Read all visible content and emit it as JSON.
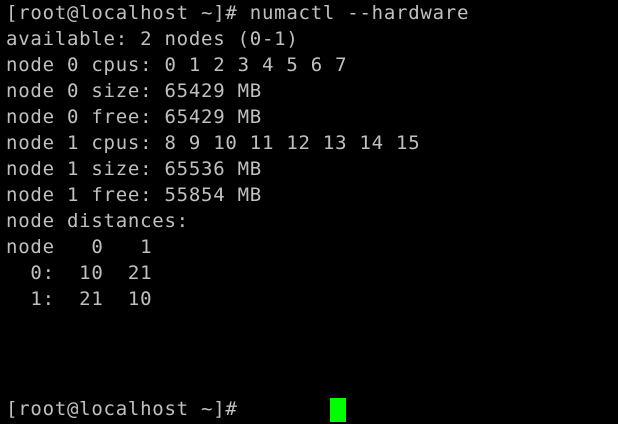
{
  "terminal": {
    "colors": {
      "background": "#000000",
      "foreground": "#c0c0c0",
      "cursor": "#00ff00"
    },
    "lines": [
      "[root@localhost ~]# numactl --hardware",
      "available: 2 nodes (0-1)",
      "node 0 cpus: 0 1 2 3 4 5 6 7",
      "node 0 size: 65429 MB",
      "node 0 free: 65429 MB",
      "node 1 cpus: 8 9 10 11 12 13 14 15",
      "node 1 size: 65536 MB",
      "node 1 free: 55854 MB",
      "node distances:",
      "node   0   1",
      "  0:  10  21",
      "  1:  21  10",
      "[root@localhost ~]#"
    ]
  }
}
